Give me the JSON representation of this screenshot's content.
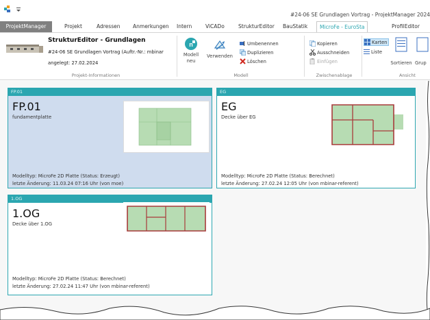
{
  "titlebar": {
    "title": "#24-06 SE Grundlagen Vortrag - ProjektManager 2024",
    "quick_access": [
      "app-icon",
      "customize-icon"
    ]
  },
  "tabs": [
    {
      "label": "ProjektManager",
      "active": false,
      "app": true
    },
    {
      "label": "Projekt"
    },
    {
      "label": "Adressen"
    },
    {
      "label": "Anmerkungen"
    },
    {
      "label": "Intern"
    },
    {
      "label": "ViCADo"
    },
    {
      "label": "StrukturEditor"
    },
    {
      "label": "BauStatik"
    },
    {
      "label": "MicroFe - EuroSta",
      "active": true
    },
    {
      "label": "ProfilEditor"
    }
  ],
  "ribbon": {
    "project": {
      "title": "StrukturEditor - Grundlagen",
      "description": "#24-06 SE Grundlagen Vortrag (Auftr.-Nr.: mbinar",
      "date": "angelegt: 27.02.2024",
      "group_label": "Projekt-Informationen"
    },
    "model": {
      "new_label": "Modell neu",
      "use_label": "Verwenden",
      "rename_label": "Umbenennen",
      "duplicate_label": "Duplizieren",
      "delete_label": "Löschen",
      "group_label": "Modell"
    },
    "clipboard": {
      "copy_label": "Kopieren",
      "cut_label": "Ausschneiden",
      "paste_label": "Einfügen",
      "group_label": "Zwischenablage"
    },
    "view": {
      "cards_label": "Karten",
      "list_label": "Liste",
      "sort_label": "Sortieren",
      "group_partial_label": "Grup",
      "group_label": "Ansicht"
    }
  },
  "cards": [
    {
      "header": "FP.01",
      "name": "FP.01",
      "description": "fundamentplatte",
      "model_type": "Modelltyp: MicroFe 2D Platte (Status: Erzeugt)",
      "last_change": "letzte Änderung: 11.03.24 07:16 Uhr (von moe)",
      "selected": true
    },
    {
      "header": "EG",
      "name": "EG",
      "description": "Decke über EG",
      "model_type": "Modelltyp: MicroFe 2D Platte (Status: Berechnet)",
      "last_change": "letzte Änderung: 27.02.24 12:05 Uhr (von mbinar-referent)",
      "selected": false
    },
    {
      "header": "1.OG",
      "name": "1.OG",
      "description": "Decke über 1.OG",
      "model_type": "Modelltyp: MicroFe 2D Platte (Status: Berechnet)",
      "last_change": "letzte Änderung: 27.02.24 11:47 Uhr (von mbinar-referent)",
      "selected": false
    }
  ],
  "colors": {
    "accent": "#2ba6b0",
    "selected_card": "#cfdcee",
    "slab_fill": "#b7dcb3",
    "wall": "#a83a3a"
  }
}
